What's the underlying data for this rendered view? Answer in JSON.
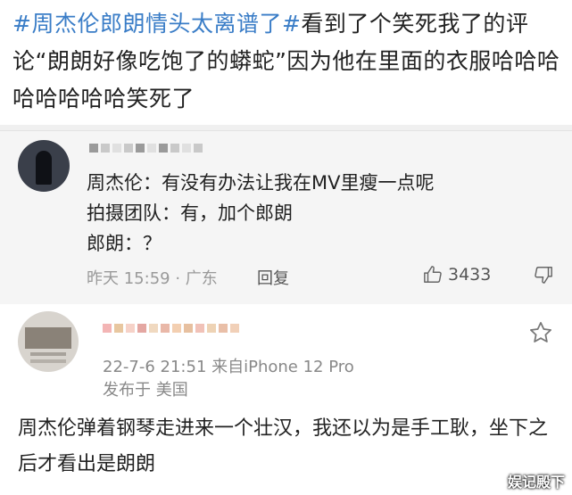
{
  "post": {
    "hashtag": "#周杰伦郎朗情头太离谱了#",
    "text": "看到了个笑死我了的评论“朗朗好像吃饱了的蟒蛇”因为他在里面的衣服哈哈哈哈哈哈哈哈笑死了"
  },
  "comment1": {
    "lines": [
      "周杰伦：有没有办法让我在MV里瘦一点呢",
      "拍摄团队：有，加个郎朗",
      "郎朗：？"
    ],
    "meta": "昨天 15:59 · 广东",
    "reply_label": "回复",
    "like_count": "3433"
  },
  "comment2": {
    "date_device": "22-7-6 21:51  来自iPhone 12 Pro",
    "location": "发布于 美国",
    "text": "周杰伦弹着钢琴走进来一个壮汉，我还以为是手工耿，坐下之后才看出是朗朗"
  },
  "watermark": "娱记殿下",
  "colors": {
    "hashtag": "#3a7dc7",
    "comment_bg": "#f5f5f5",
    "meta": "#999999"
  }
}
